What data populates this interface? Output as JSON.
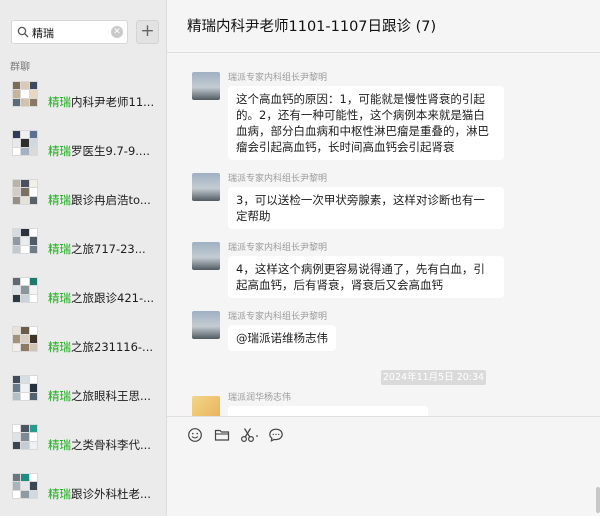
{
  "search": {
    "value": "精瑞",
    "clear_icon": "✕"
  },
  "add_button": {
    "label": "+"
  },
  "section_label": "群聊",
  "groups": [
    {
      "highlight": "精瑞",
      "rest": "内科尹老师11..."
    },
    {
      "highlight": "精瑞",
      "rest": "罗医生9.7-9...."
    },
    {
      "highlight": "精瑞",
      "rest": "跟诊冉启浩to..."
    },
    {
      "highlight": "精瑞",
      "rest": "之旅717-23..."
    },
    {
      "highlight": "精瑞",
      "rest": "之旅跟诊421-..."
    },
    {
      "highlight": "精瑞",
      "rest": "之旅231116-..."
    },
    {
      "highlight": "精瑞",
      "rest": "之旅眼科王思..."
    },
    {
      "highlight": "精瑞",
      "rest": "之类骨科李代..."
    },
    {
      "highlight": "精瑞",
      "rest": "跟诊外科杜老..."
    }
  ],
  "chat": {
    "title": "精瑞内科尹老师1101-1107日跟诊 (7)",
    "messages": [
      {
        "sender": "瑞派专家内科组长尹黎明",
        "text": "这个高血钙的原因：1，可能就是慢性肾衰的引起的。2，还有一种可能性，这个病例本来就是猫白血病，部分白血病和中枢性淋巴瘤是重叠的，淋巴瘤会引起高血钙，长时间高血钙会引起肾衰"
      },
      {
        "sender": "瑞派专家内科组长尹黎明",
        "text": "3，可以送检一次甲状旁腺素，这样对诊断也有一定帮助"
      },
      {
        "sender": "瑞派专家内科组长尹黎明",
        "text": "4，这样这个病例更容易说得通了，先有白血，引起高血钙，后有肾衰，肾衰后又会高血钙"
      },
      {
        "sender": "瑞派专家内科组长尹黎明",
        "text": "@瑞派诺维杨志伟"
      }
    ],
    "timestamp": "2024年11月5日 20:34",
    "last_sender": "瑞派润华杨志伟"
  },
  "colors": {
    "highlight": "#1aad19",
    "bubble": "#ffffff",
    "sidebar": "#ebebeb"
  },
  "tool_icons": [
    "emoji-icon",
    "folder-icon",
    "scissors-icon",
    "chat-history-icon"
  ]
}
